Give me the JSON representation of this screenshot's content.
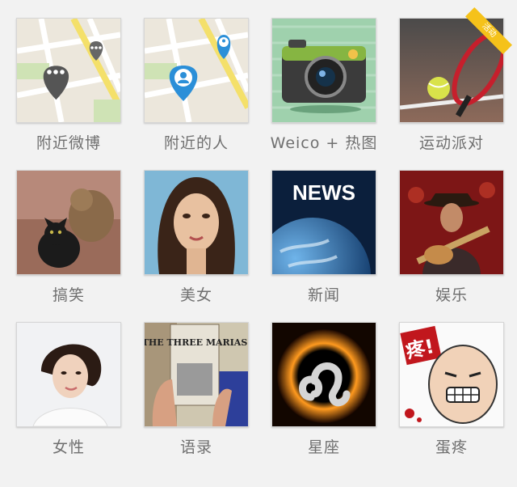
{
  "tiles": [
    {
      "label": "附近微博"
    },
    {
      "label": "附近的人"
    },
    {
      "label": "Weico + 热图"
    },
    {
      "label": "运动派对",
      "badge": "活动"
    },
    {
      "label": "搞笑"
    },
    {
      "label": "美女"
    },
    {
      "label": "新闻",
      "thumb_text": "NEWS"
    },
    {
      "label": "娱乐"
    },
    {
      "label": "女性"
    },
    {
      "label": "语录",
      "thumb_text": "THE THREE MARIAS"
    },
    {
      "label": "星座"
    },
    {
      "label": "蛋疼",
      "thumb_text": "疼!"
    }
  ],
  "colors": {
    "background": "#f2f2f2",
    "label": "#6f6f6f",
    "badge": "#f5c21a",
    "map_pin_blue": "#2b8fd8"
  }
}
